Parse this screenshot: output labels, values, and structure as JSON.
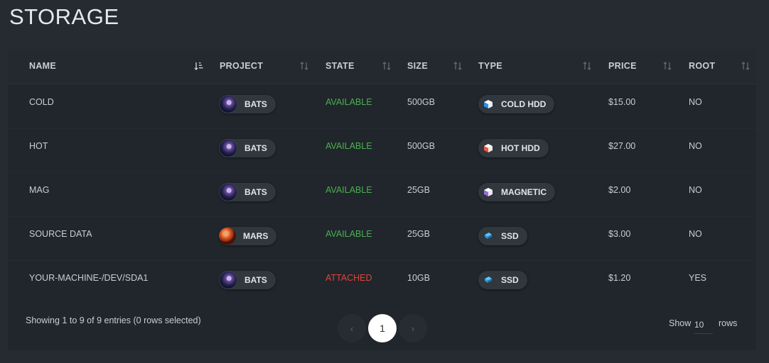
{
  "page": {
    "title": "STORAGE"
  },
  "table": {
    "columns": [
      {
        "label": "NAME",
        "sort": "ascending"
      },
      {
        "label": "PROJECT",
        "sort": "none"
      },
      {
        "label": "STATE",
        "sort": "none"
      },
      {
        "label": "SIZE",
        "sort": "none"
      },
      {
        "label": "TYPE",
        "sort": "none"
      },
      {
        "label": "PRICE",
        "sort": "none"
      },
      {
        "label": "ROOT",
        "sort": "none"
      }
    ],
    "rows": [
      {
        "name": "COLD",
        "project": "BATS",
        "state": "AVAILABLE",
        "size": "500GB",
        "type": "COLD HDD",
        "price": "$15.00",
        "root": "NO"
      },
      {
        "name": "HOT",
        "project": "BATS",
        "state": "AVAILABLE",
        "size": "500GB",
        "type": "HOT HDD",
        "price": "$27.00",
        "root": "NO"
      },
      {
        "name": "MAG",
        "project": "BATS",
        "state": "AVAILABLE",
        "size": "25GB",
        "type": "MAGNETIC",
        "price": "$2.00",
        "root": "NO"
      },
      {
        "name": "SOURCE DATA",
        "project": "MARS",
        "state": "AVAILABLE",
        "size": "25GB",
        "type": "SSD",
        "price": "$3.00",
        "root": "NO"
      },
      {
        "name": "YOUR-MACHINE-/DEV/SDA1",
        "project": "BATS",
        "state": "ATTACHED",
        "size": "10GB",
        "type": "SSD",
        "price": "$1.20",
        "root": "YES"
      }
    ]
  },
  "footer": {
    "summary": "Showing 1 to 9 of 9 entries (0 rows selected)",
    "pager": {
      "prev": "‹",
      "current": "1",
      "next": "›"
    },
    "show_label": "Show",
    "rows_per_page": "10",
    "rows_label": "rows"
  },
  "colors": {
    "available": "#4caf50",
    "attached": "#e0443a",
    "cold_hdd": "#2196f3",
    "hot_hdd": "#f05545",
    "magnetic": "#9c6ade",
    "ssd": "#1e9be8"
  },
  "icons": {
    "project_avatar_bats": "bats-avatar-icon",
    "project_avatar_mars": "mars-avatar-icon",
    "type_cube": "cube-icon",
    "sort": "sort-arrows-icon"
  }
}
